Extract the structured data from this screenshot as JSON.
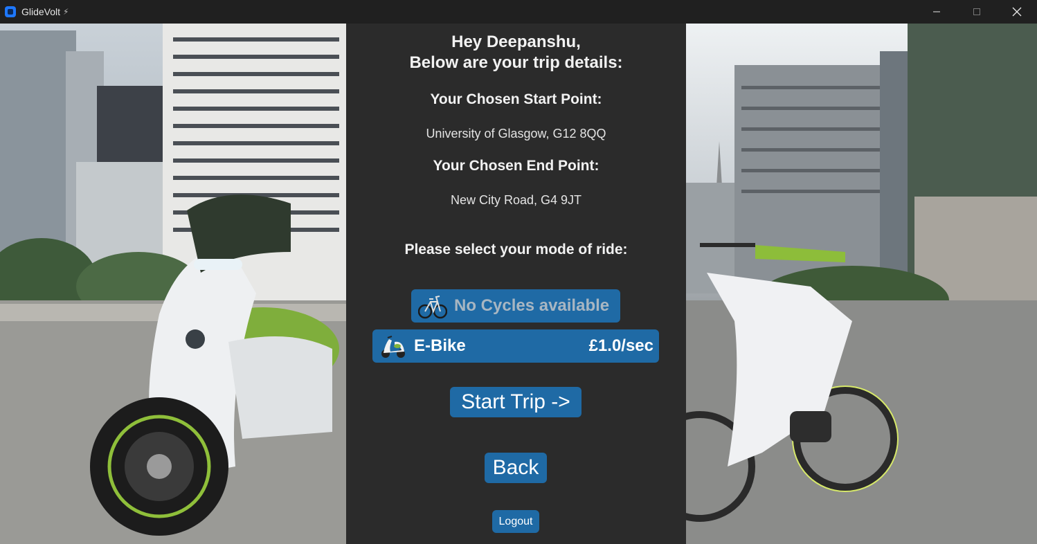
{
  "window": {
    "title": "GlideVolt",
    "title_suffix_icon": "lightning-icon",
    "controls": [
      "minimize-icon",
      "maximize-icon",
      "close-icon"
    ]
  },
  "images": {
    "left": "electric-scooter-photo",
    "right": "electric-bicycle-photo"
  },
  "panel": {
    "greeting_line1": "Hey Deepanshu,",
    "greeting_line2": "Below are your trip details:",
    "start_label": "Your Chosen Start Point:",
    "start_value": "University of Glasgow, G12 8QQ",
    "end_label": "Your Chosen End Point:",
    "end_value": "New City Road, G4 9JT",
    "mode_prompt": "Please select your mode of ride:",
    "cycle_option": {
      "icon": "bicycle-icon",
      "label": "No Cycles available"
    },
    "ebike_option": {
      "icon": "scooter-icon",
      "label": "E-Bike",
      "price": "£1.0/sec"
    },
    "start_button": "Start Trip ->",
    "back_button": "Back",
    "logout_button": "Logout"
  },
  "colors": {
    "accent": "#1f6aa5",
    "panel_bg": "#2b2b2b",
    "titlebar_bg": "#202020"
  }
}
